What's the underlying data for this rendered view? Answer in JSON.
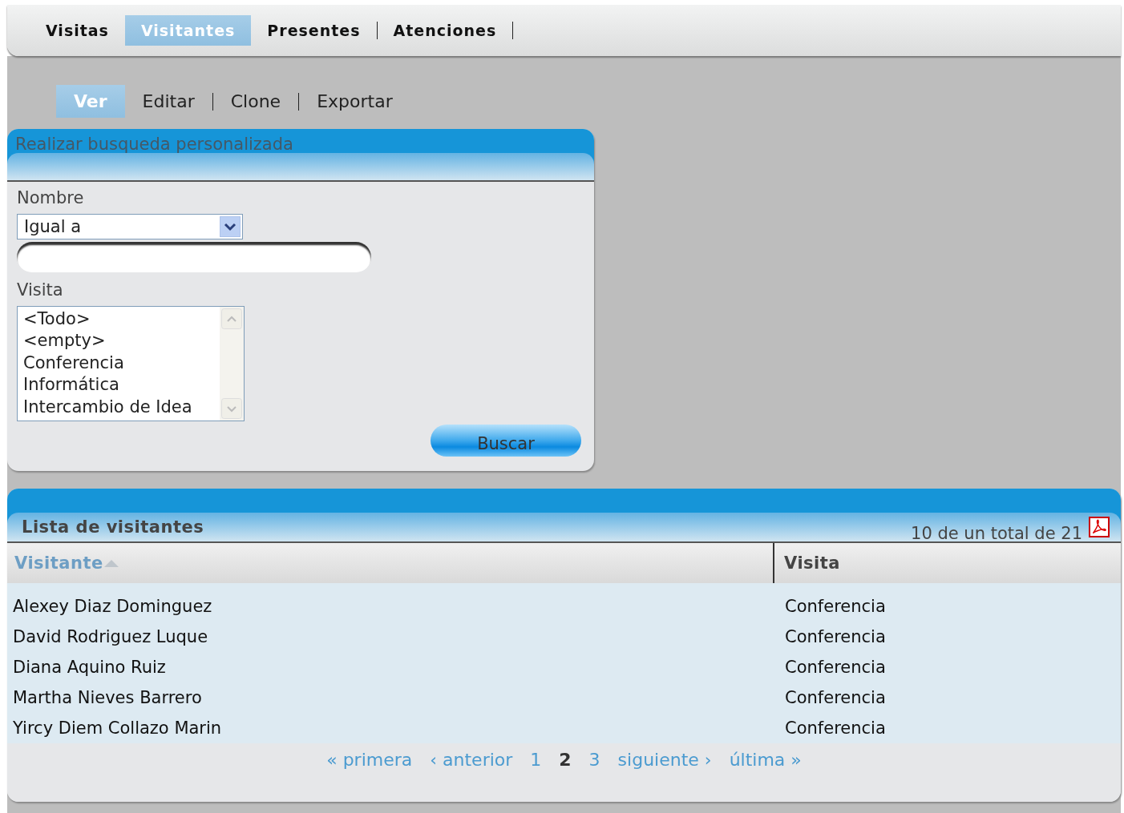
{
  "top_tabs": [
    {
      "label": "Visitas",
      "selected": false
    },
    {
      "label": "Visitantes",
      "selected": true
    },
    {
      "label": "Presentes",
      "selected": false
    },
    {
      "label": "Atenciones",
      "selected": false
    }
  ],
  "sub_tabs": [
    {
      "label": "Ver",
      "selected": true
    },
    {
      "label": "Editar",
      "selected": false
    },
    {
      "label": "Clone",
      "selected": false
    },
    {
      "label": "Exportar",
      "selected": false
    }
  ],
  "search": {
    "title": "Realizar busqueda personalizada",
    "fields": [
      {
        "kind": "select-text",
        "label": "Nombre",
        "operator": "Igual a"
      },
      {
        "kind": "listbox",
        "label": "Visita",
        "options": [
          "<Todo>",
          "<empty>",
          "Conferencia",
          "Informática",
          "Intercambio de Idea"
        ]
      }
    ],
    "button": "Buscar"
  },
  "list": {
    "title": "Lista de visitantes",
    "summary": "10 de un total de 21",
    "columns": [
      {
        "label": "Visitante",
        "sorted": true
      },
      {
        "label": "Visita",
        "sorted": false
      }
    ],
    "rows": [
      {
        "cells": [
          "Alexey Diaz Dominguez",
          "Conferencia"
        ]
      },
      {
        "cells": [
          "David Rodriguez Luque",
          "Conferencia"
        ]
      },
      {
        "cells": [
          "Diana Aquino Ruiz",
          "Conferencia"
        ]
      },
      {
        "cells": [
          "Martha Nieves Barrero",
          "Conferencia"
        ]
      },
      {
        "cells": [
          "Yircy Diem Collazo Marin",
          "Conferencia"
        ]
      }
    ],
    "pagination": [
      {
        "label": "« primera",
        "selected": false
      },
      {
        "label": "‹ anterior",
        "selected": false
      },
      {
        "label": "1",
        "selected": false
      },
      {
        "label": "2",
        "selected": true
      },
      {
        "label": "3",
        "selected": false
      },
      {
        "label": "siguiente ›",
        "selected": false
      },
      {
        "label": "última »",
        "selected": false
      }
    ]
  }
}
